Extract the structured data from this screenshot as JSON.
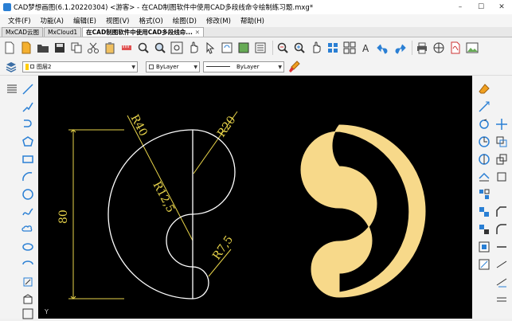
{
  "window": {
    "title": "CAD梦想画图(6.1.20220304) <游客> - 在CAD制图软件中使用CAD多段线命令绘制练习题.mxg*",
    "controls": [
      "–",
      "☐",
      "✕"
    ]
  },
  "menu": [
    "文件(F)",
    "功能(A)",
    "编辑(E)",
    "视图(V)",
    "格式(O)",
    "绘图(D)",
    "修改(M)",
    "帮助(H)"
  ],
  "tabs": [
    {
      "label": "MxCAD云图",
      "active": false
    },
    {
      "label": "MxCloud1",
      "active": false
    },
    {
      "label": "在CAD制图软件中使用CAD多段线命...",
      "active": true
    }
  ],
  "properties": {
    "layer": "图层2",
    "color": "ByLayer",
    "linetype": "ByLayer"
  },
  "drawing": {
    "dims": {
      "r40": "R40",
      "r20": "R20",
      "r125": "R12,5",
      "r75": "R7,5",
      "d80": "80"
    },
    "ucs": "Y",
    "colors": {
      "outline": "#ffffff",
      "dimension": "#e8d44a",
      "fill": "#f7d98a"
    }
  }
}
